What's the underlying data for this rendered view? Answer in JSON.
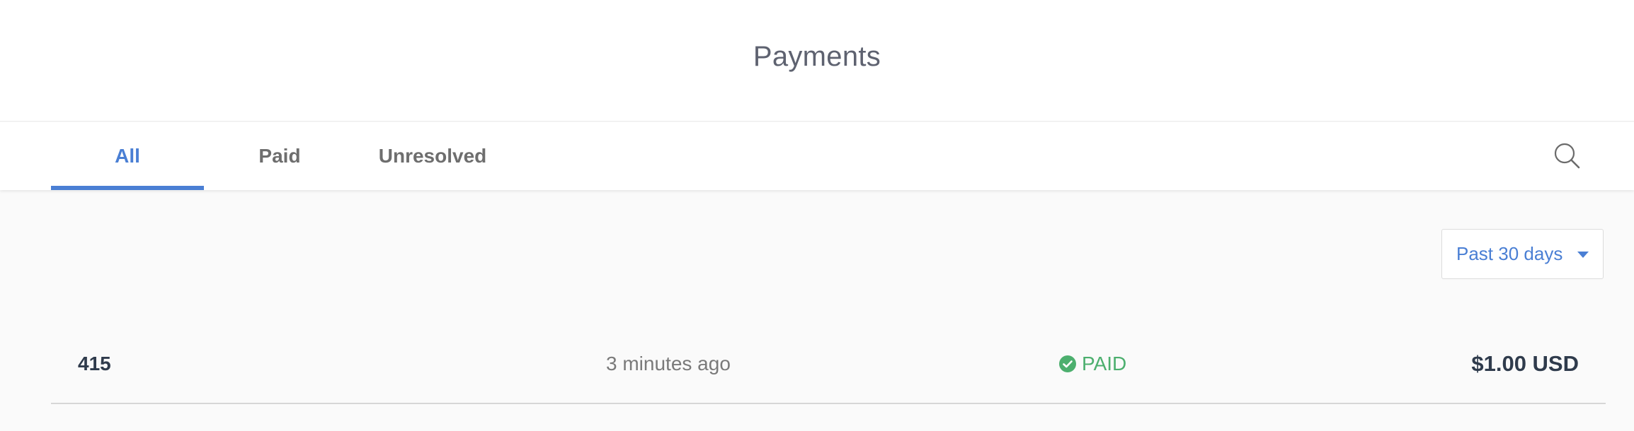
{
  "page": {
    "title": "Payments"
  },
  "tabs": [
    {
      "label": "All",
      "active": true
    },
    {
      "label": "Paid",
      "active": false
    },
    {
      "label": "Unresolved",
      "active": false
    }
  ],
  "search": {
    "icon": "search-icon"
  },
  "filter": {
    "selected": "Past 30 days",
    "icon": "caret-down-icon"
  },
  "payments": [
    {
      "id": "415",
      "time": "3 minutes ago",
      "status": "PAID",
      "status_icon": "check-circle-icon",
      "amount": "$1.00 USD"
    }
  ],
  "colors": {
    "accent": "#4a7fd4",
    "paid": "#4caf6e",
    "title": "#5e6270",
    "primary_text": "#2f3b4c",
    "secondary_text": "#7a7a7a",
    "background": "#fafafa"
  }
}
